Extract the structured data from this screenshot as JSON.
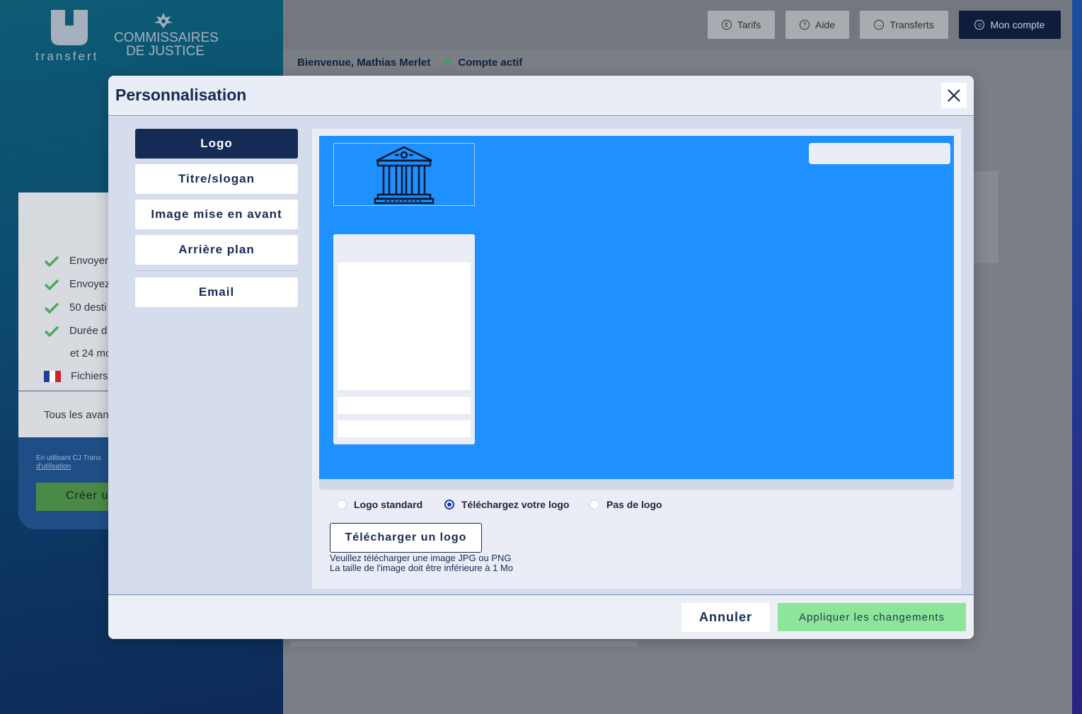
{
  "brand": {
    "app_name": "transfert",
    "org_line1": "COMMISSAIRES",
    "org_line2": "DE JUSTICE"
  },
  "nav": {
    "tarifs": "Tarifs",
    "aide": "Aide",
    "transferts": "Transferts",
    "mon_compte": "Mon compte"
  },
  "welcome": {
    "greeting": "Bienvenue, Mathias Merlet",
    "status": "Compte actif",
    "status_color": "#3e9e5a"
  },
  "offer": {
    "features": [
      "Envoyer",
      "Envoyez",
      "50 desti",
      "Durée d",
      "et 24 mo",
      "Fichiers"
    ],
    "footer": "Tous les avan",
    "legal_text": "En utilisant CJ Trans",
    "legal_link": "d'utilisation",
    "create_label": "Créer u"
  },
  "modal": {
    "title": "Personnalisation",
    "tabs": [
      "Logo",
      "Titre/slogan",
      "Image mise en avant",
      "Arrière plan",
      "Email"
    ],
    "active_tab": "Logo",
    "preview_bg": "#1e90ff",
    "logo_options": [
      "Logo standard",
      "Téléchargez votre logo",
      "Pas de logo"
    ],
    "selected_option": "Téléchargez votre logo",
    "upload_label": "Télécharger un logo",
    "hint_line1": "Veuillez télécharger une image JPG ou PNG",
    "hint_line2": "La taille de l'image doit être inférieure à 1 Mo",
    "cancel_label": "Annuler",
    "apply_label": "Appliquer les changements",
    "apply_color": "#8de59a"
  }
}
